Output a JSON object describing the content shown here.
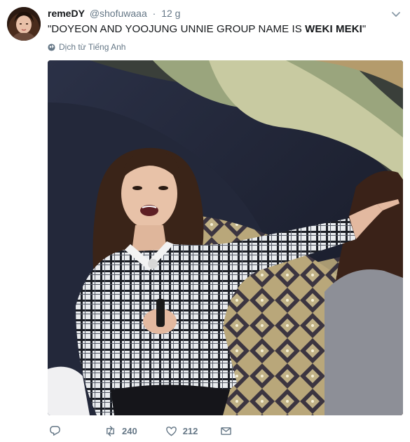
{
  "tweet": {
    "display_name": "remeDY",
    "screen_name": "@shofuwaaa",
    "separator": "·",
    "timestamp": "12 g",
    "text_prefix": "\"DOYEON AND YOOJUNG UNNIE GROUP NAME IS ",
    "text_bold": "WEKI MEKI",
    "text_suffix": "\"",
    "translate_label": "Dịch từ Tiếng Anh"
  },
  "actions": {
    "reply_icon": "reply-icon",
    "retweet_icon": "retweet-icon",
    "retweet_count": "240",
    "like_icon": "heart-icon",
    "like_count": "212",
    "dm_icon": "envelope-icon"
  },
  "icons": {
    "more": "chevron-down-icon",
    "translate": "globe-icon"
  },
  "colors": {
    "text": "#14171a",
    "secondary": "#657786"
  }
}
